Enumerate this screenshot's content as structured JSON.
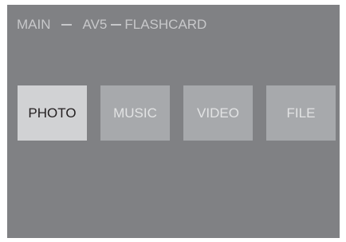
{
  "header": {
    "main": "MAIN",
    "input": "AV5",
    "source": "FLASHCARD"
  },
  "menu": {
    "items": [
      {
        "label": "PHOTO",
        "selected": true
      },
      {
        "label": "MUSIC",
        "selected": false
      },
      {
        "label": "VIDEO",
        "selected": false
      },
      {
        "label": "FILE",
        "selected": false
      }
    ]
  },
  "colors": {
    "screen_background": "#808184",
    "tile": "#a7a9ac",
    "tile_selected": "#d1d2d4",
    "header_text": "#c7c8ca"
  }
}
